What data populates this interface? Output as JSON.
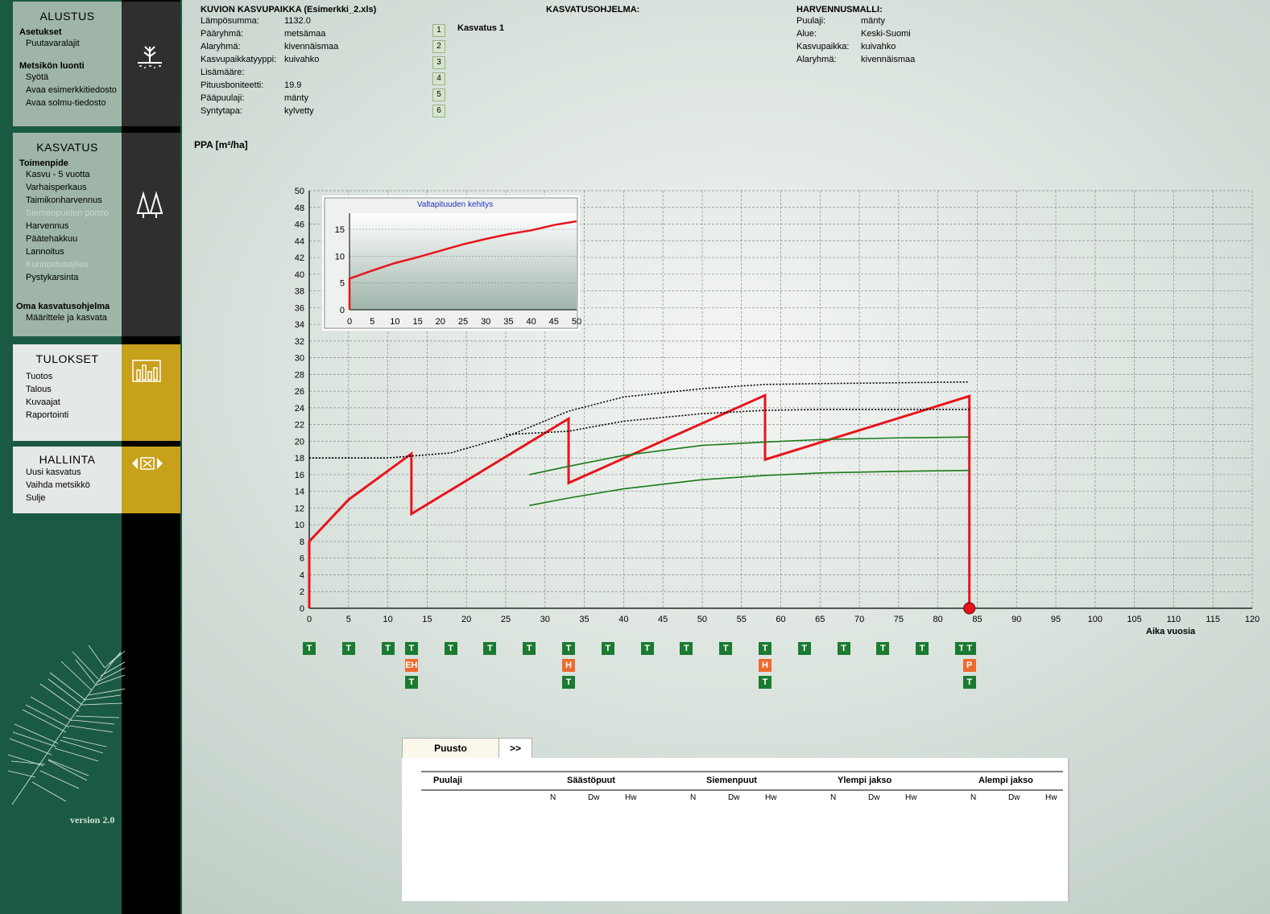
{
  "sidebar": {
    "alustus": {
      "title": "ALUSTUS",
      "asetukset": "Asetukset",
      "puutavaralajit": "Puutavaralajit",
      "metsikon": "Metsikön luonti",
      "syota": "Syötä",
      "avaa_esim": "Avaa esimerkkitiedosto",
      "avaa_solmu": "Avaa solmu-tiedosto"
    },
    "kasvatus": {
      "title": "KASVATUS",
      "toimenpide": "Toimenpide",
      "items": [
        "Kasvu - 5 vuotta",
        "Varhaisperkaus",
        "Taimikonharvennus",
        "Siemenpuiden poisto",
        "Harvennus",
        "Päätehakkuu",
        "Lannoitus",
        "Kunnostusojitus",
        "Pystykarsinta"
      ],
      "oma": "Oma kasvatusohjelma",
      "maarittele": "Määrittele ja kasvata"
    },
    "tulokset": {
      "title": "TULOKSET",
      "items": [
        "Tuotos",
        "Talous",
        "Kuvaajat",
        "Raportointi"
      ]
    },
    "hallinta": {
      "title": "HALLINTA",
      "items": [
        "Uusi kasvatus",
        "Vaihda metsikkö",
        "Sulje"
      ]
    },
    "version": "version 2.0"
  },
  "kuvio": {
    "title": "KUVION KASVUPAIKKA (Esimerkki_2.xls)",
    "rows": [
      {
        "k": "Lämpösumma:",
        "v": "1132.0"
      },
      {
        "k": "Pääryhmä:",
        "v": "metsämaa"
      },
      {
        "k": "Alaryhmä:",
        "v": "kivennäismaa"
      },
      {
        "k": "Kasvupaikkatyyppi:",
        "v": "kuivahko"
      },
      {
        "k": "Lisämääre:",
        "v": ""
      },
      {
        "k": "Pituusboniteetti:",
        "v": "19.9"
      },
      {
        "k": "Pääpuulaji:",
        "v": "mänty"
      },
      {
        "k": "Syntytapa:",
        "v": "kylvetty"
      }
    ]
  },
  "steps": [
    "1",
    "2",
    "3",
    "4",
    "5",
    "6"
  ],
  "kasvatusohjelma": {
    "title": "KASVATUSOHJELMA:",
    "value": "Kasvatus 1"
  },
  "harvennusmalli": {
    "title": "HARVENNUSMALLI:",
    "rows": [
      {
        "k": "Puulaji:",
        "v": "mänty"
      },
      {
        "k": "Alue:",
        "v": "Keski-Suomi"
      },
      {
        "k": "Kasvupaikka:",
        "v": "kuivahko"
      },
      {
        "k": "Alaryhmä:",
        "v": "kivennäismaa"
      }
    ]
  },
  "chart_data": [
    {
      "type": "line",
      "ylabel": "PPA [m²/ha]",
      "xlabel": "Aika vuosia",
      "xlim": [
        0,
        120
      ],
      "ylim": [
        0,
        50
      ],
      "xticks": [
        0,
        5,
        10,
        15,
        20,
        25,
        30,
        35,
        40,
        45,
        50,
        55,
        60,
        65,
        70,
        75,
        80,
        85,
        90,
        95,
        100,
        105,
        110,
        115,
        120
      ],
      "yticks": [
        0,
        2,
        4,
        6,
        8,
        10,
        12,
        14,
        16,
        18,
        20,
        22,
        24,
        26,
        28,
        30,
        32,
        34,
        36,
        38,
        40,
        42,
        44,
        46,
        48,
        50
      ],
      "grid": true,
      "series": [
        {
          "color": "#e8141c",
          "style": "solid",
          "x": [
            0,
            0,
            5,
            13,
            13,
            33,
            33,
            58,
            58,
            84,
            84
          ],
          "y": [
            0,
            8,
            13,
            18.5,
            11.3,
            22.7,
            15,
            25.5,
            17.8,
            25.4,
            0
          ]
        },
        {
          "color": "#000000",
          "style": "dotted",
          "x": [
            0,
            10,
            18,
            25,
            33,
            40,
            50,
            58,
            65,
            75,
            84
          ],
          "y": [
            18,
            18,
            18.6,
            20.5,
            23.6,
            25.3,
            26.3,
            26.8,
            26.9,
            27,
            27.1
          ]
        },
        {
          "color": "#000000",
          "style": "dotted",
          "x": [
            25,
            33,
            40,
            50,
            58,
            65,
            75,
            84
          ],
          "y": [
            20.8,
            21.2,
            22.4,
            23.3,
            23.7,
            23.8,
            23.8,
            23.8
          ]
        },
        {
          "color": "#1a7a1a",
          "style": "solid",
          "x": [
            28,
            33,
            40,
            50,
            58,
            65,
            75,
            84
          ],
          "y": [
            16,
            17,
            18.3,
            19.5,
            19.9,
            20.2,
            20.4,
            20.5
          ]
        },
        {
          "color": "#1a7a1a",
          "style": "solid",
          "x": [
            28,
            33,
            40,
            50,
            58,
            65,
            75,
            84
          ],
          "y": [
            12.3,
            13.2,
            14.3,
            15.4,
            15.9,
            16.2,
            16.4,
            16.5
          ]
        }
      ],
      "end_marker": {
        "x": 84,
        "y": 0
      }
    },
    {
      "type": "line",
      "title": "Valtapituuden kehitys",
      "xlim": [
        0,
        50
      ],
      "ylim": [
        0,
        18
      ],
      "xticks": [
        0,
        5,
        10,
        15,
        20,
        25,
        30,
        35,
        40,
        45,
        50
      ],
      "yticks": [
        0,
        5,
        10,
        15
      ],
      "series": [
        {
          "color": "#e8141c",
          "x": [
            0,
            0,
            5,
            10,
            15,
            20,
            25,
            30,
            35,
            40,
            45,
            50
          ],
          "y": [
            0,
            5.8,
            7.3,
            8.7,
            9.8,
            11.0,
            12.2,
            13.2,
            14.1,
            14.8,
            15.8,
            16.5
          ]
        }
      ]
    }
  ],
  "markers": {
    "row1": [
      {
        "x": 0,
        "label": "T"
      },
      {
        "x": 5,
        "label": "T"
      },
      {
        "x": 10,
        "label": "T"
      },
      {
        "x": 13,
        "label": "T"
      },
      {
        "x": 18,
        "label": "T"
      },
      {
        "x": 23,
        "label": "T"
      },
      {
        "x": 28,
        "label": "T"
      },
      {
        "x": 33,
        "label": "T"
      },
      {
        "x": 38,
        "label": "T"
      },
      {
        "x": 43,
        "label": "T"
      },
      {
        "x": 48,
        "label": "T"
      },
      {
        "x": 53,
        "label": "T"
      },
      {
        "x": 58,
        "label": "T"
      },
      {
        "x": 63,
        "label": "T"
      },
      {
        "x": 68,
        "label": "T"
      },
      {
        "x": 73,
        "label": "T"
      },
      {
        "x": 78,
        "label": "T"
      },
      {
        "x": 83,
        "label": "T"
      },
      {
        "x": 84,
        "label": "T"
      }
    ],
    "row2": [
      {
        "x": 13,
        "label": "EH"
      },
      {
        "x": 33,
        "label": "H"
      },
      {
        "x": 58,
        "label": "H"
      },
      {
        "x": 84,
        "label": "P"
      }
    ],
    "row3": [
      {
        "x": 13,
        "label": "T"
      },
      {
        "x": 33,
        "label": "T"
      },
      {
        "x": 58,
        "label": "T"
      },
      {
        "x": 84,
        "label": "T"
      }
    ]
  },
  "tabs": {
    "puusto": "Puusto",
    "next": ">>"
  },
  "table": {
    "puulaji": "Puulaji",
    "groups": [
      "Säästöpuut",
      "Siemenpuut",
      "Ylempi jakso",
      "Alempi jakso"
    ],
    "subcols": [
      "N",
      "Dw",
      "Hw"
    ]
  }
}
